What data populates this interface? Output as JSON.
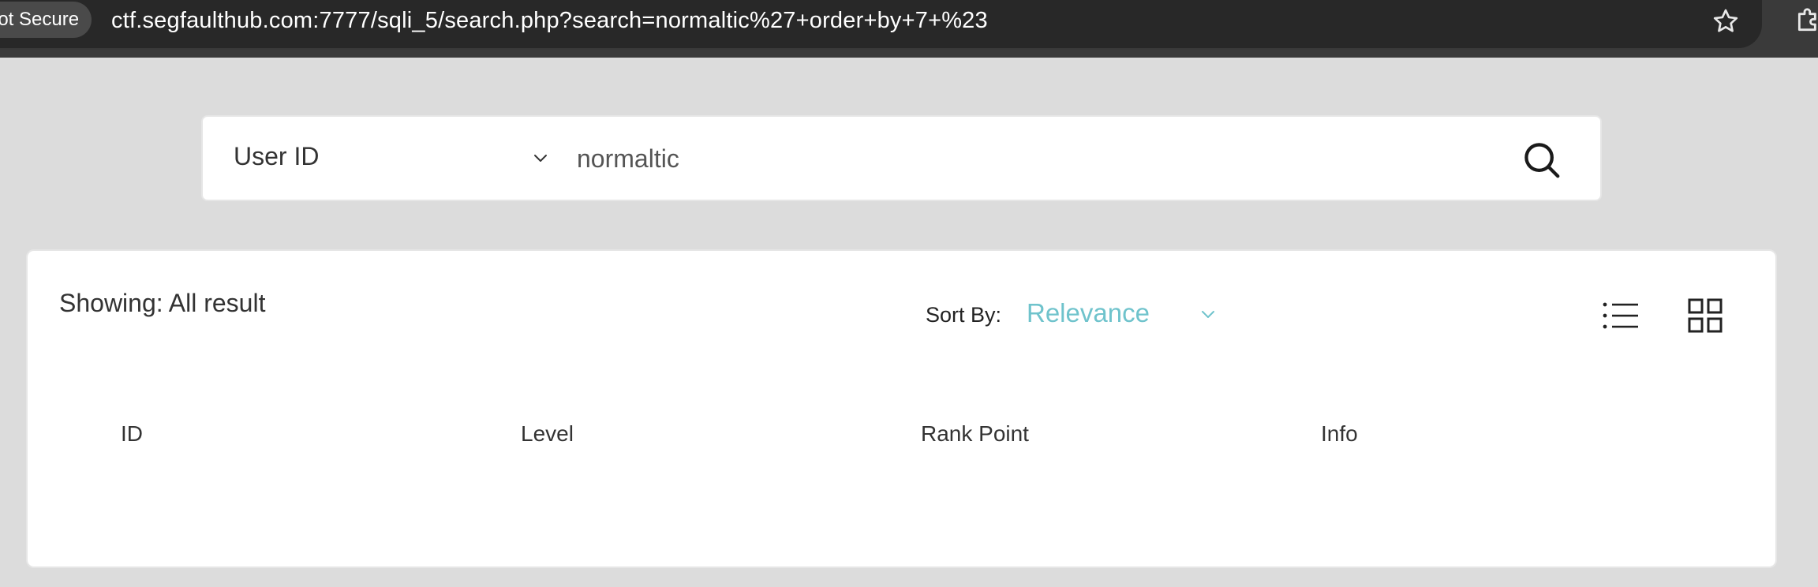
{
  "browser": {
    "security_label": "Not Secure",
    "url": "ctf.segfaulthub.com:7777/sqli_5/search.php?search=normaltic%27+order+by+7+%23",
    "icons": [
      "star-icon",
      "extension-icon"
    ]
  },
  "search": {
    "field_select": "User ID",
    "query_value": "normaltic",
    "icons": [
      "chevron-down-icon",
      "search-icon"
    ]
  },
  "results": {
    "showing_label": "Showing: All result",
    "sort_by_label": "Sort By:",
    "sort_value": "Relevance",
    "view_icons": [
      "list-view-icon",
      "grid-view-icon"
    ],
    "columns": [
      "ID",
      "Level",
      "Rank Point",
      "Info"
    ],
    "rows": []
  },
  "colors": {
    "page_background": "#dcdcdc",
    "accent": "#6fc3cc",
    "browser_bar": "#282828"
  }
}
